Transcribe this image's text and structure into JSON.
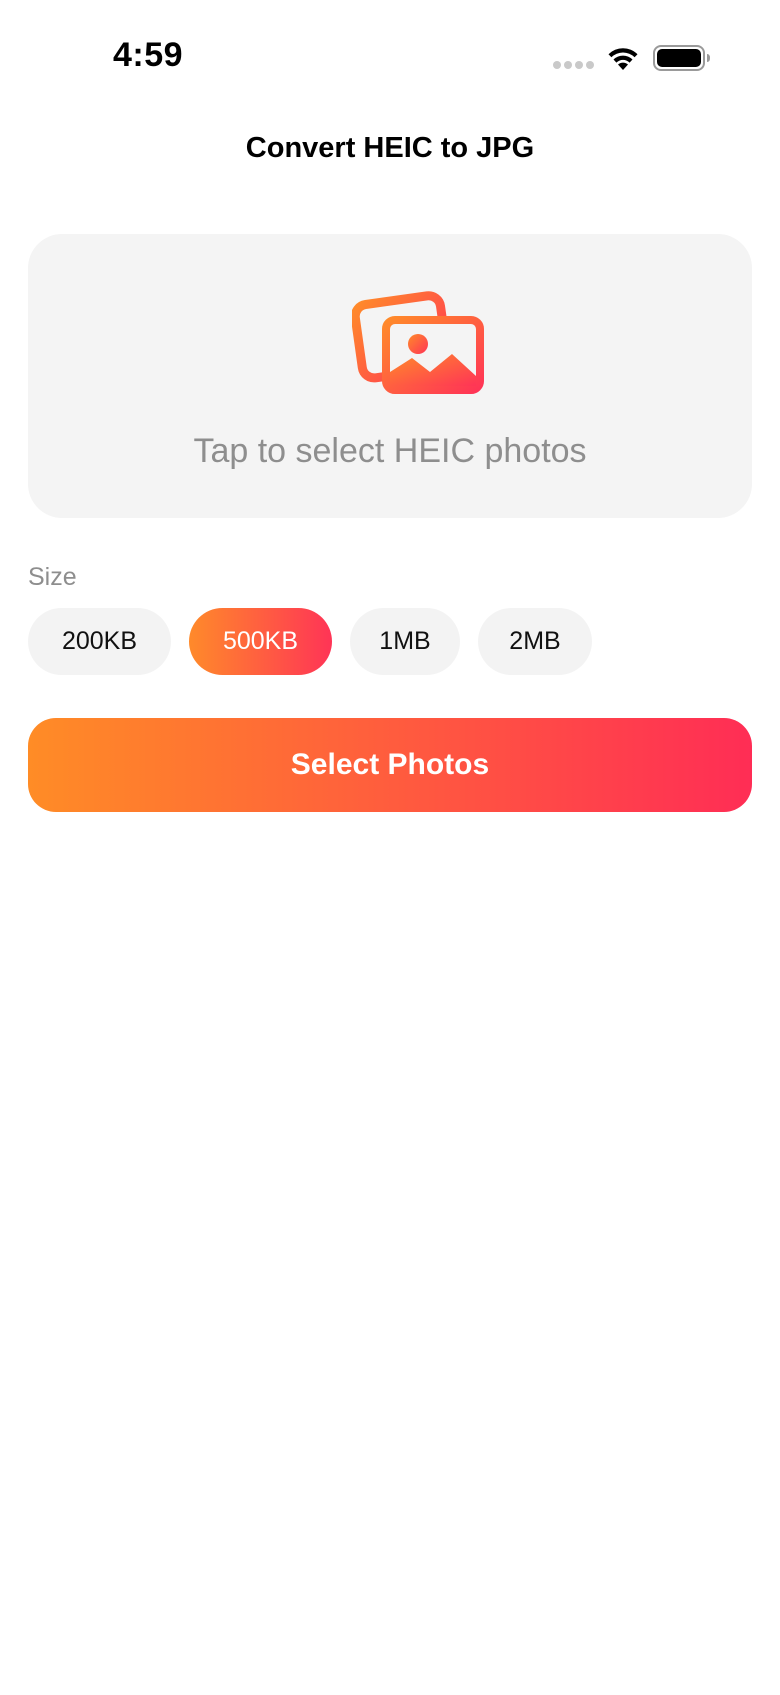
{
  "status_bar": {
    "time": "4:59"
  },
  "header": {
    "title": "Convert HEIC to JPG"
  },
  "drop_zone": {
    "icon": "photos-icon",
    "label": "Tap to select HEIC photos"
  },
  "size": {
    "label": "Size",
    "options": [
      {
        "label": "200KB",
        "selected": false
      },
      {
        "label": "500KB",
        "selected": true
      },
      {
        "label": "1MB",
        "selected": false
      },
      {
        "label": "2MB",
        "selected": false
      }
    ]
  },
  "primary_button": {
    "label": "Select Photos"
  },
  "colors": {
    "accent_start": "#ff8c26",
    "accent_end": "#ff2d55",
    "panel_bg": "#f4f4f4",
    "secondary_text": "#8e8e8e"
  }
}
